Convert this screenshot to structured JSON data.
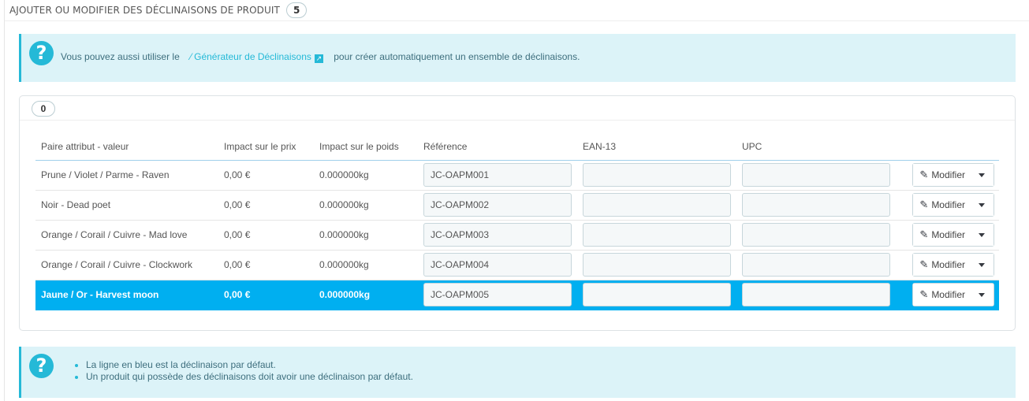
{
  "header": {
    "title": "Ajouter ou modifier des déclinaisons de produit",
    "count": "5"
  },
  "info_top": {
    "icon": "question-icon",
    "before": "Vous pouvez aussi utiliser le",
    "link": "Générateur de Déclinaisons",
    "after": "pour créer automatiquement un ensemble de déclinaisons."
  },
  "list": {
    "count": "0"
  },
  "table": {
    "columns": [
      "Paire attribut - valeur",
      "Impact sur le prix",
      "Impact sur le poids",
      "Référence",
      "EAN-13",
      "UPC",
      ""
    ],
    "rows": [
      {
        "attr": "Prune / Violet / Parme - Raven",
        "price": "0,00 €",
        "weight": "0.000000kg",
        "reference": "JC-OAPM001",
        "ean13": "",
        "upc": "",
        "action": "Modifier"
      },
      {
        "attr": "Noir - Dead poet",
        "price": "0,00 €",
        "weight": "0.000000kg",
        "reference": "JC-OAPM002",
        "ean13": "",
        "upc": "",
        "action": "Modifier"
      },
      {
        "attr": "Orange / Corail / Cuivre - Mad love",
        "price": "0,00 €",
        "weight": "0.000000kg",
        "reference": "JC-OAPM003",
        "ean13": "",
        "upc": "",
        "action": "Modifier"
      },
      {
        "attr": "Orange / Corail / Cuivre - Clockwork",
        "price": "0,00 €",
        "weight": "0.000000kg",
        "reference": "JC-OAPM004",
        "ean13": "",
        "upc": "",
        "action": "Modifier"
      },
      {
        "attr": "Jaune / Or - Harvest moon",
        "price": "0,00 €",
        "weight": "0.000000kg",
        "reference": "JC-OAPM005",
        "ean13": "",
        "upc": "",
        "action": "Modifier"
      }
    ]
  },
  "info_bottom": {
    "items": [
      "La ligne en bleu est la déclinaison par défaut.",
      "Un produit qui possède des déclinaisons doit avoir une déclinaison par défaut."
    ]
  },
  "colors": {
    "accent": "#25b9d7",
    "default_row": "#00aff0",
    "alert_bg": "#dcf3f8"
  }
}
